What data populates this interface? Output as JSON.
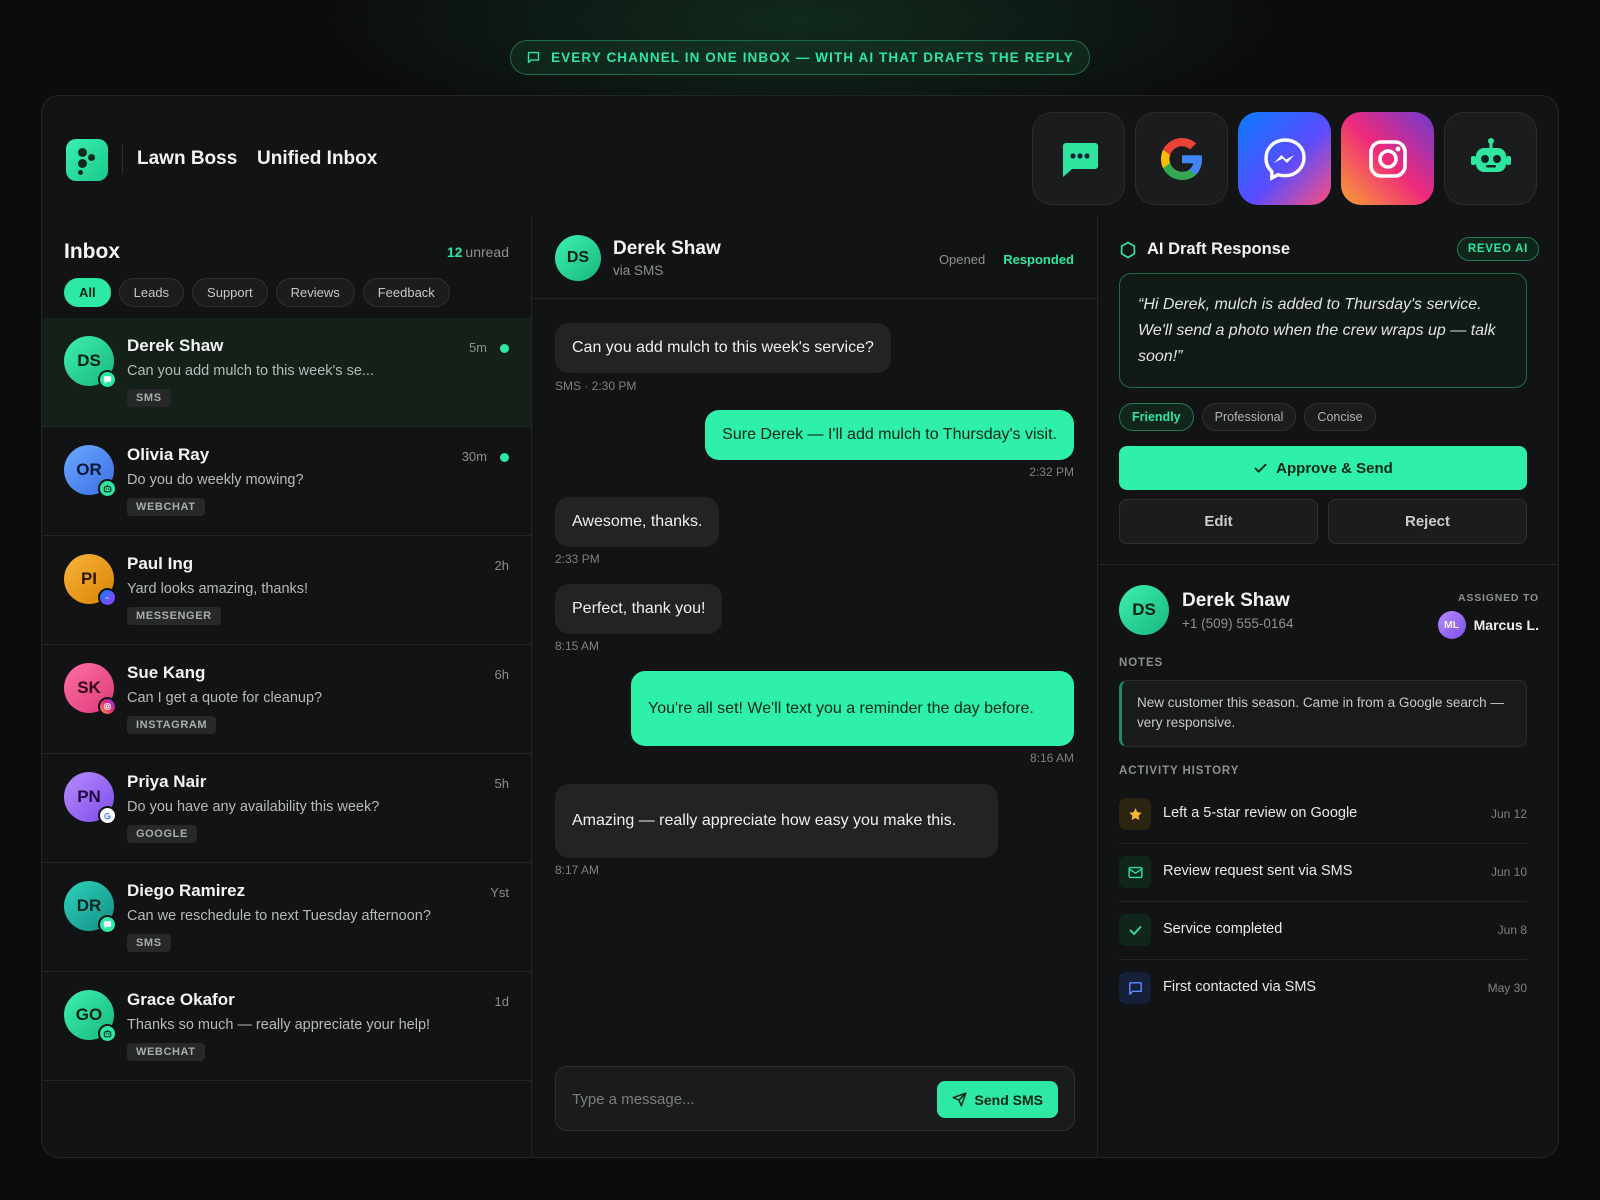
{
  "banner": {
    "text": "EVERY CHANNEL IN ONE INBOX — WITH AI THAT DRAFTS THE REPLY"
  },
  "header": {
    "brand": "Lawn Boss",
    "title": "Unified Inbox"
  },
  "channels": [
    "sms-icon",
    "google-icon",
    "messenger-icon",
    "instagram-icon",
    "robot-icon"
  ],
  "colors": {
    "accent": "#2de9a4",
    "background": "#121314",
    "panel": "#1b1c1d"
  },
  "inbox": {
    "title": "Inbox",
    "unread_count": "12",
    "unread_label": "unread",
    "filters": [
      "All",
      "Leads",
      "Support",
      "Reviews",
      "Feedback"
    ],
    "active_filter": "All",
    "conversations": [
      {
        "initials": "DS",
        "name": "Derek Shaw",
        "time": "5m",
        "preview": "Can you add mulch to this week's se...",
        "channel": "SMS",
        "unread": true
      },
      {
        "initials": "OR",
        "name": "Olivia Ray",
        "time": "30m",
        "preview": "Do you do weekly mowing?",
        "channel": "WEBCHAT",
        "unread": true
      },
      {
        "initials": "PI",
        "name": "Paul Ing",
        "time": "2h",
        "preview": "Yard looks amazing, thanks!",
        "channel": "MESSENGER",
        "unread": false
      },
      {
        "initials": "SK",
        "name": "Sue Kang",
        "time": "6h",
        "preview": "Can I get a quote for cleanup?",
        "channel": "INSTAGRAM",
        "unread": false
      },
      {
        "initials": "PN",
        "name": "Priya Nair",
        "time": "5h",
        "preview": "Do you have any availability this week?",
        "channel": "GOOGLE",
        "unread": false
      },
      {
        "initials": "DR",
        "name": "Diego Ramirez",
        "time": "Yst",
        "preview": "Can we reschedule to next Tuesday afternoon?",
        "channel": "SMS",
        "unread": false
      },
      {
        "initials": "GO",
        "name": "Grace Okafor",
        "time": "1d",
        "preview": "Thanks so much — really appreciate your help!",
        "channel": "WEBCHAT",
        "unread": false
      }
    ]
  },
  "chat": {
    "initials": "DS",
    "name": "Derek Shaw",
    "via": "via SMS",
    "status_opened": "Opened",
    "status_responded": "Responded",
    "messages": [
      {
        "dir": "in",
        "text": "Can you add mulch to this week's service?",
        "time": "SMS · 2:30 PM"
      },
      {
        "dir": "out",
        "text": "Sure Derek — I'll add mulch to Thursday's visit.",
        "time": "2:32 PM"
      },
      {
        "dir": "in",
        "text": "Awesome, thanks.",
        "time": "2:33 PM"
      },
      {
        "dir": "in",
        "text": "Perfect, thank you!",
        "time": "8:15 AM"
      },
      {
        "dir": "out",
        "text": "You're all set! We'll text you a reminder the day before.",
        "time": "8:16 AM"
      },
      {
        "dir": "in",
        "text": "Amazing — really appreciate how easy you make this.",
        "time": "8:17 AM"
      }
    ],
    "composer_placeholder": "Type a message...",
    "send_label": "Send SMS"
  },
  "ai": {
    "title": "AI Draft Response",
    "badge": "REVEO AI",
    "draft": "“Hi Derek, mulch is added to Thursday's service. We'll send a photo when the crew wraps up — talk soon!”",
    "tones": [
      "Friendly",
      "Professional",
      "Concise"
    ],
    "active_tone": "Friendly",
    "approve_label": "Approve & Send",
    "edit_label": "Edit",
    "reject_label": "Reject"
  },
  "contact": {
    "initials": "DS",
    "name": "Derek Shaw",
    "phone": "+1 (509) 555-0164",
    "assigned_label": "ASSIGNED TO",
    "assignee_initials": "ML",
    "assignee_name": "Marcus L.",
    "notes_label": "NOTES",
    "notes": "New customer this season. Came in from a Google search — very responsive.",
    "activity_label": "ACTIVITY HISTORY",
    "activity": [
      {
        "icon": "star-icon",
        "text": "Left a 5-star review on Google",
        "date": "Jun 12"
      },
      {
        "icon": "mail-icon",
        "text": "Review request sent via SMS",
        "date": "Jun 10"
      },
      {
        "icon": "check-icon",
        "text": "Service completed",
        "date": "Jun 8"
      },
      {
        "icon": "chat-icon",
        "text": "First contacted via SMS",
        "date": "May 30"
      }
    ]
  }
}
